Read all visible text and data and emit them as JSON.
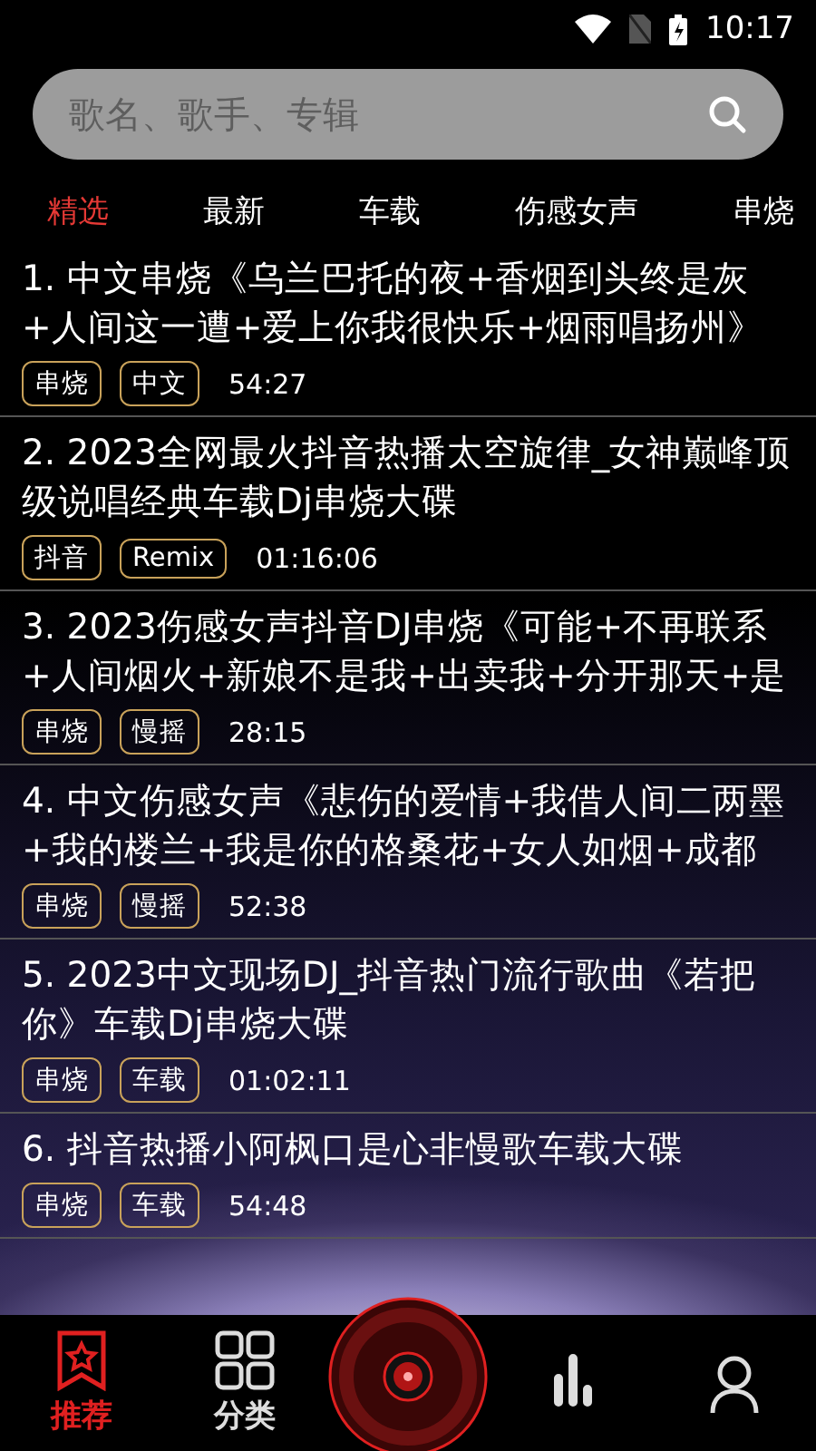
{
  "status_bar": {
    "time": "10:17"
  },
  "search": {
    "placeholder": "歌名、歌手、专辑"
  },
  "tabs": [
    {
      "label": "精选",
      "selected": true
    },
    {
      "label": "最新",
      "selected": false
    },
    {
      "label": "车载",
      "selected": false
    },
    {
      "label": "伤感女声",
      "selected": false
    },
    {
      "label": "串烧",
      "selected": false
    }
  ],
  "songs": [
    {
      "title": "1. 中文串烧《乌兰巴托的夜+香烟到头终是灰+人间这一遭+爱上你我很快乐+烟雨唱扬州》",
      "tags": [
        "串烧",
        "中文"
      ],
      "duration": "54:27"
    },
    {
      "title": "2. 2023全网最火抖音热播太空旋律_女神巅峰顶级说唱经典车载Dj串烧大碟",
      "tags": [
        "抖音",
        "Remix"
      ],
      "duration": "01:16:06"
    },
    {
      "title": "3. 2023伤感女声抖音DJ串烧《可能+不再联系+人间烟火+新娘不是我+出卖我+分开那天+是",
      "tags": [
        "串烧",
        "慢摇"
      ],
      "duration": "28:15"
    },
    {
      "title": "4. 中文伤感女声《悲伤的爱情+我借人间二两墨+我的楼兰+我是你的格桑花+女人如烟+成都",
      "tags": [
        "串烧",
        "慢摇"
      ],
      "duration": "52:38"
    },
    {
      "title": "5. 2023中文现场DJ_抖音热门流行歌曲《若把你》车载Dj串烧大碟",
      "tags": [
        "串烧",
        "车载"
      ],
      "duration": "01:02:11"
    },
    {
      "title": "6. 抖音热播小阿枫口是心非慢歌车载大碟",
      "tags": [
        "串烧",
        "车载"
      ],
      "duration": "54:48"
    }
  ],
  "nav": [
    {
      "kind": "star",
      "label": "推荐",
      "selected": true
    },
    {
      "kind": "grid",
      "label": "分类",
      "selected": false
    },
    {
      "kind": "disc"
    },
    {
      "kind": "music",
      "selected": false
    },
    {
      "kind": "person",
      "selected": false
    }
  ]
}
